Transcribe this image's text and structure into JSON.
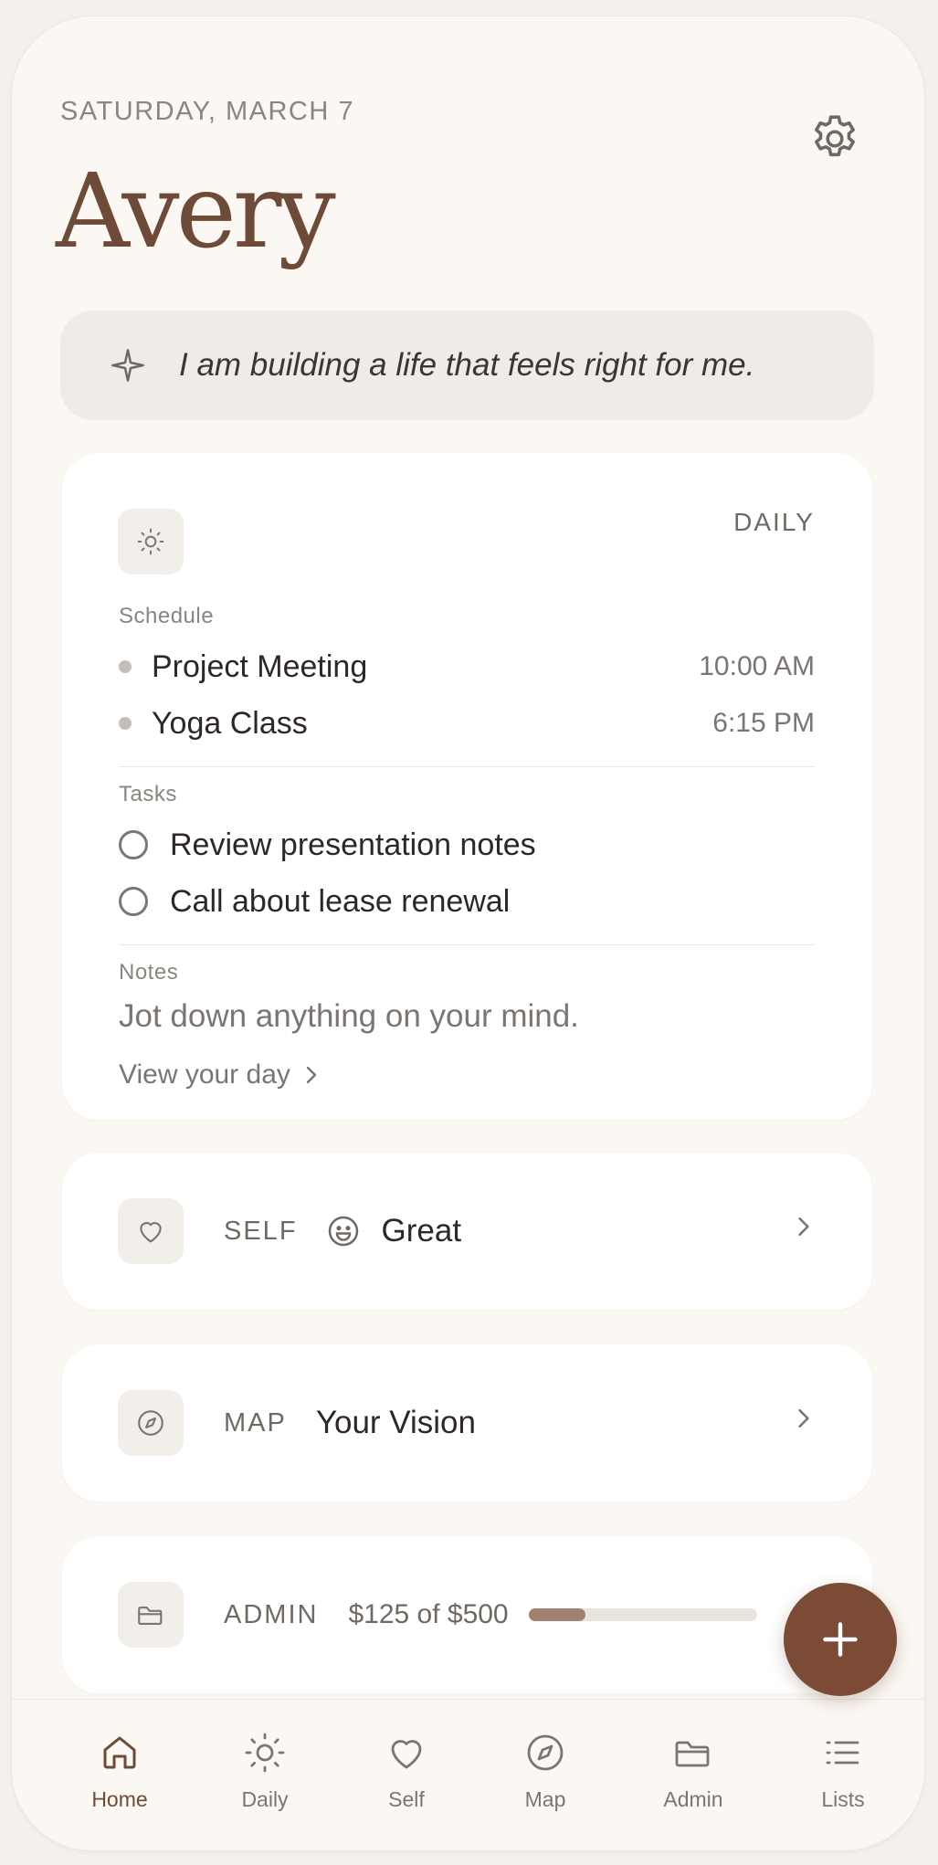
{
  "header": {
    "date": "SATURDAY, MARCH 7",
    "name": "Avery",
    "settings_icon": "gear-icon"
  },
  "affirmation": {
    "icon": "sparkle-icon",
    "text": "I am building a life that feels right for me."
  },
  "daily": {
    "icon": "sun-icon",
    "badge": "DAILY",
    "schedule_label": "Schedule",
    "schedule": [
      {
        "title": "Project Meeting",
        "time": "10:00 AM"
      },
      {
        "title": "Yoga Class",
        "time": "6:15 PM"
      }
    ],
    "tasks_label": "Tasks",
    "tasks": [
      {
        "title": "Review presentation notes",
        "done": false
      },
      {
        "title": "Call about lease renewal",
        "done": false
      }
    ],
    "notes_label": "Notes",
    "notes_placeholder": "Jot down anything on your mind.",
    "view_link": "View your day"
  },
  "self": {
    "icon": "heart-icon",
    "label": "SELF",
    "mood_icon": "smiley-icon",
    "mood": "Great"
  },
  "map": {
    "icon": "compass-icon",
    "label": "MAP",
    "value": "Your Vision"
  },
  "admin": {
    "icon": "folder-icon",
    "label": "ADMIN",
    "budget_text": "$125 of $500",
    "spent": 125,
    "total": 500,
    "progress_color": "#a08070"
  },
  "fab": {
    "icon": "plus-icon",
    "color": "#7b4b36"
  },
  "tabs": [
    {
      "label": "Home",
      "icon": "home-icon",
      "active": true
    },
    {
      "label": "Daily",
      "icon": "sun-icon",
      "active": false
    },
    {
      "label": "Self",
      "icon": "heart-icon",
      "active": false
    },
    {
      "label": "Map",
      "icon": "compass-icon",
      "active": false
    },
    {
      "label": "Admin",
      "icon": "folder-icon",
      "active": false
    },
    {
      "label": "Lists",
      "icon": "list-icon",
      "active": false
    }
  ],
  "colors": {
    "background": "#fbf8f3",
    "accent": "#6e4a38",
    "card": "#ffffff"
  }
}
